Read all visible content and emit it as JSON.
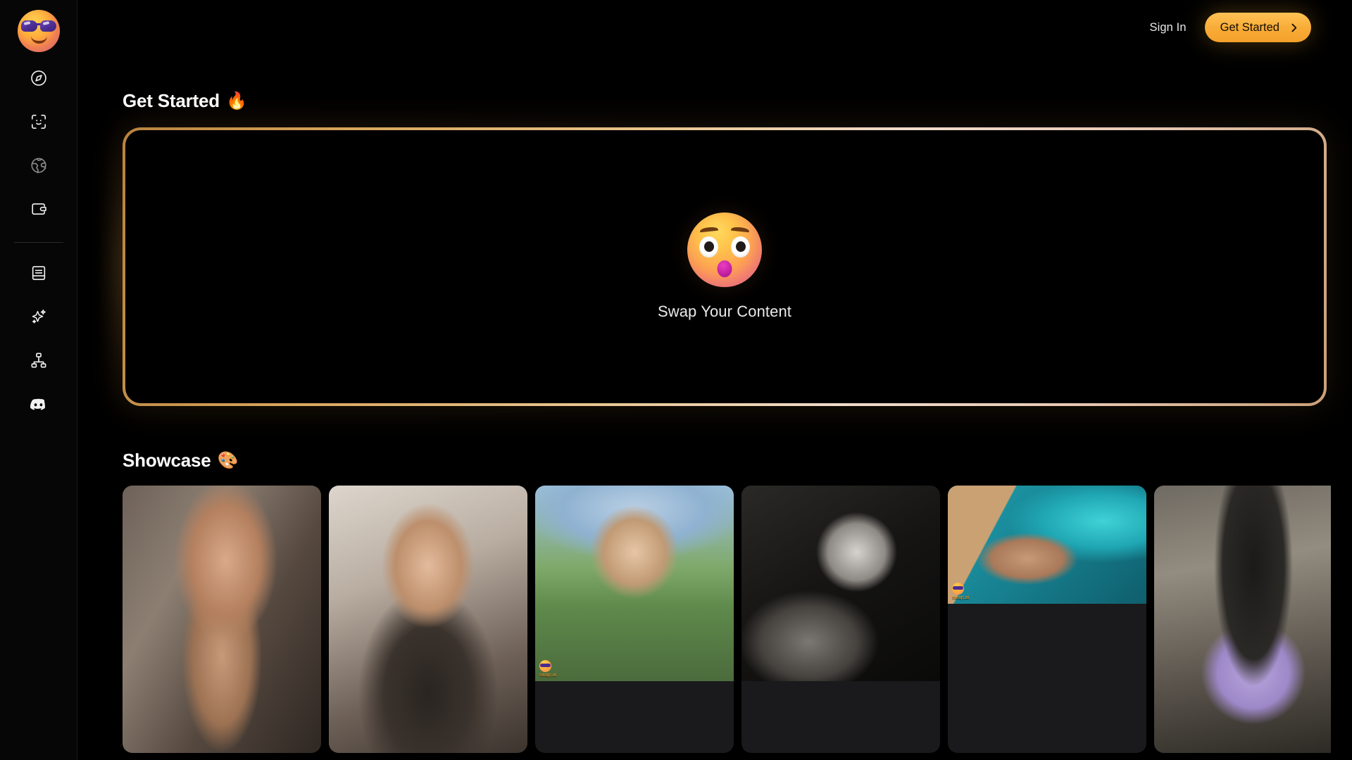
{
  "brand": {
    "logo_icon": "sunglasses-face-logo",
    "accent_color": "#f8ab36",
    "border_accent_color": "#d9a65c"
  },
  "sidebar": {
    "primary_items": [
      {
        "icon": "compass-icon",
        "name": "explore"
      },
      {
        "icon": "face-scan-icon",
        "name": "face-swap"
      },
      {
        "icon": "globe-icon",
        "name": "globe"
      },
      {
        "icon": "wallet-icon",
        "name": "wallet"
      }
    ],
    "secondary_items": [
      {
        "icon": "book-icon",
        "name": "docs"
      },
      {
        "icon": "sparkles-icon",
        "name": "ai-tools"
      },
      {
        "icon": "sitemap-icon",
        "name": "workflows"
      },
      {
        "icon": "discord-icon",
        "name": "discord"
      }
    ]
  },
  "topbar": {
    "sign_in_label": "Sign In",
    "cta_label": "Get Started",
    "cta_icon": "chevron-right-icon"
  },
  "get_started": {
    "heading": "Get Started",
    "heading_emoji": "🔥",
    "dropzone": {
      "icon": "astonished-face-emoji",
      "label": "Swap Your Content"
    }
  },
  "showcase": {
    "heading": "Showcase",
    "heading_emoji": "🎨",
    "cards": [
      {
        "name": "showcase-card-1",
        "thumb_class": "t1",
        "layout": "tall",
        "watermark": false,
        "watermark_text": ""
      },
      {
        "name": "showcase-card-2",
        "thumb_class": "t2",
        "layout": "tall",
        "watermark": false,
        "watermark_text": ""
      },
      {
        "name": "showcase-card-3",
        "thumb_class": "t3",
        "layout": "portrait",
        "watermark": true,
        "watermark_text": "swap.ai"
      },
      {
        "name": "showcase-card-4",
        "thumb_class": "t4",
        "layout": "portrait",
        "watermark": false,
        "watermark_text": ""
      },
      {
        "name": "showcase-card-5",
        "thumb_class": "t5",
        "layout": "landscape",
        "watermark": true,
        "watermark_text": "swap.ai"
      },
      {
        "name": "showcase-card-6",
        "thumb_class": "t6",
        "layout": "tall",
        "watermark": false,
        "watermark_text": ""
      }
    ]
  }
}
